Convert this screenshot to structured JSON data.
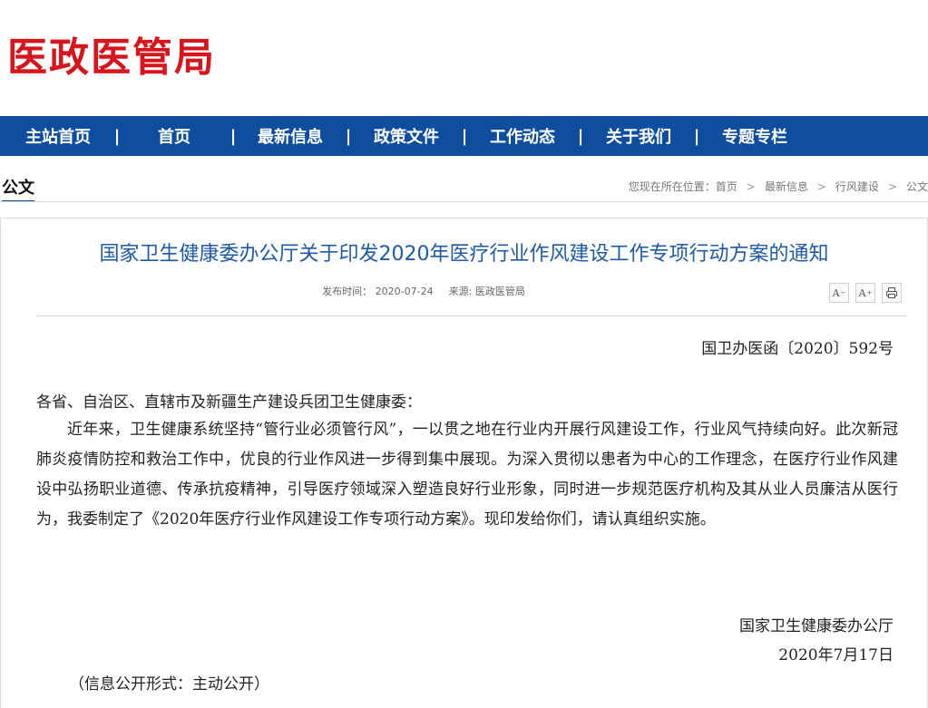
{
  "site": {
    "logo_text": "医政医管局"
  },
  "nav": {
    "items": [
      {
        "label": "主站首页"
      },
      {
        "label": "首页"
      },
      {
        "label": "最新信息"
      },
      {
        "label": "政策文件"
      },
      {
        "label": "工作动态"
      },
      {
        "label": "关于我们"
      },
      {
        "label": "专题专栏"
      }
    ],
    "separator": "|"
  },
  "section": {
    "title": "公文"
  },
  "breadcrumb": {
    "prefix": "您现在所在位置：",
    "items": [
      "首页",
      "最新信息",
      "行风建设",
      "公文"
    ],
    "separator": ">"
  },
  "article": {
    "title": "国家卫生健康委办公厅关于印发2020年医疗行业作风建设工作专项行动方案的通知",
    "meta": {
      "date_label": "发布时间：",
      "date": "2020-07-24",
      "source_label": "来源:",
      "source": "医政医管局"
    },
    "tools": {
      "font_decrease": "A",
      "font_increase": "A",
      "font_increase_sup": "+"
    },
    "doc_number": "国卫办医函〔2020〕592号",
    "addressee": "各省、自治区、直辖市及新疆生产建设兵团卫生健康委：",
    "body": "近年来，卫生健康系统坚持“管行业必须管行风”，一以贯之地在行业内开展行风建设工作，行业风气持续向好。此次新冠肺炎疫情防控和救治工作中，优良的行业作风进一步得到集中展现。为深入贯彻以患者为中心的工作理念，在医疗行业作风建设中弘扬职业道德、传承抗疫精神，引导医疗领域深入塑造良好行业形象，同时进一步规范医疗机构及其从业人员廉洁从医行为，我委制定了《2020年医疗行业作风建设工作专项行动方案》。现印发给你们，请认真组织实施。",
    "signer": "国家卫生健康委办公厅",
    "sign_date": "2020年7月17日",
    "disclosure": "（信息公开形式：主动公开）"
  }
}
